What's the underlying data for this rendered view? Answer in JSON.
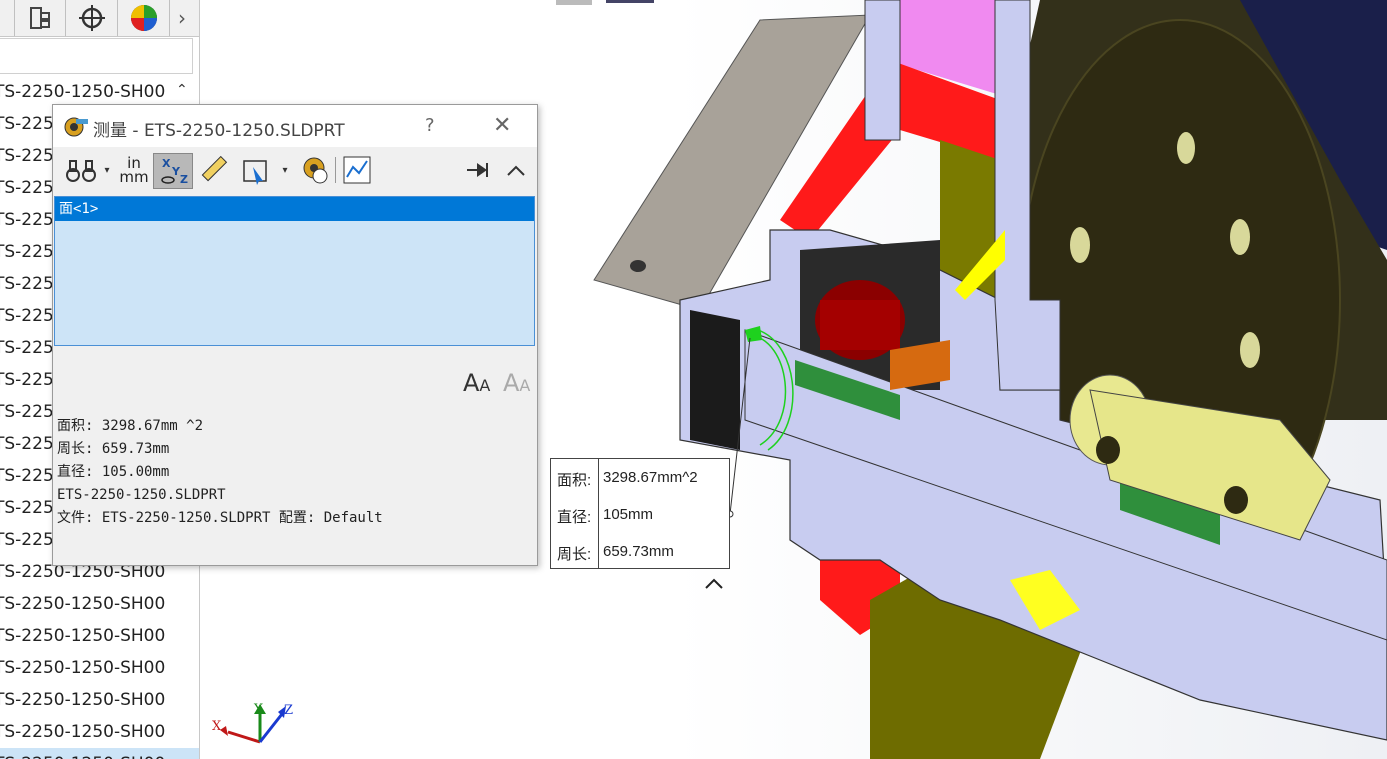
{
  "tree": {
    "items": [
      "TS-2250-1250-SH00",
      "TS-225",
      "TS-225",
      "TS-225",
      "TS-225",
      "TS-225",
      "TS-225",
      "TS-225",
      "TS-225",
      "TS-225",
      "TS-225",
      "TS-225",
      "TS-225",
      "TS-225",
      "TS-225",
      "TS-2250-1250-SH00",
      "TS-2250-1250-SH00",
      "TS-2250-1250-SH00",
      "TS-2250-1250-SH00",
      "TS-2250-1250-SH00",
      "TS-2250-1250-SH00",
      "TS-2250-1250-SH00"
    ]
  },
  "dialog": {
    "title": "测量 - ETS-2250-1250.SLDPRT",
    "help": "?",
    "close": "✕",
    "units_in": "in",
    "units_mm": "mm",
    "selection": "面<1>",
    "results": {
      "area": "面积: 3298.67mm ^2",
      "perimeter": "周长: 659.73mm",
      "diameter": "直径: 105.00mm",
      "part": "ETS-2250-1250.SLDPRT",
      "file": "文件: ETS-2250-1250.SLDPRT 配置: Default"
    }
  },
  "callout": {
    "area_label": "面积:",
    "area_value": "3298.67mm^2",
    "diameter_label": "直径:",
    "diameter_value": "105mm",
    "perimeter_label": "周长:",
    "perimeter_value": "659.73mm"
  },
  "triad": {
    "x": "X",
    "y": "Y",
    "z": "Z"
  },
  "colors": {
    "selection": "#0078d7",
    "list_bg": "#cde4f7",
    "part_body": "#c8ccf0",
    "red": "#ff0000",
    "magenta": "#f08af0",
    "olive": "#7a7a00",
    "dark_olive": "#2e2a12"
  }
}
